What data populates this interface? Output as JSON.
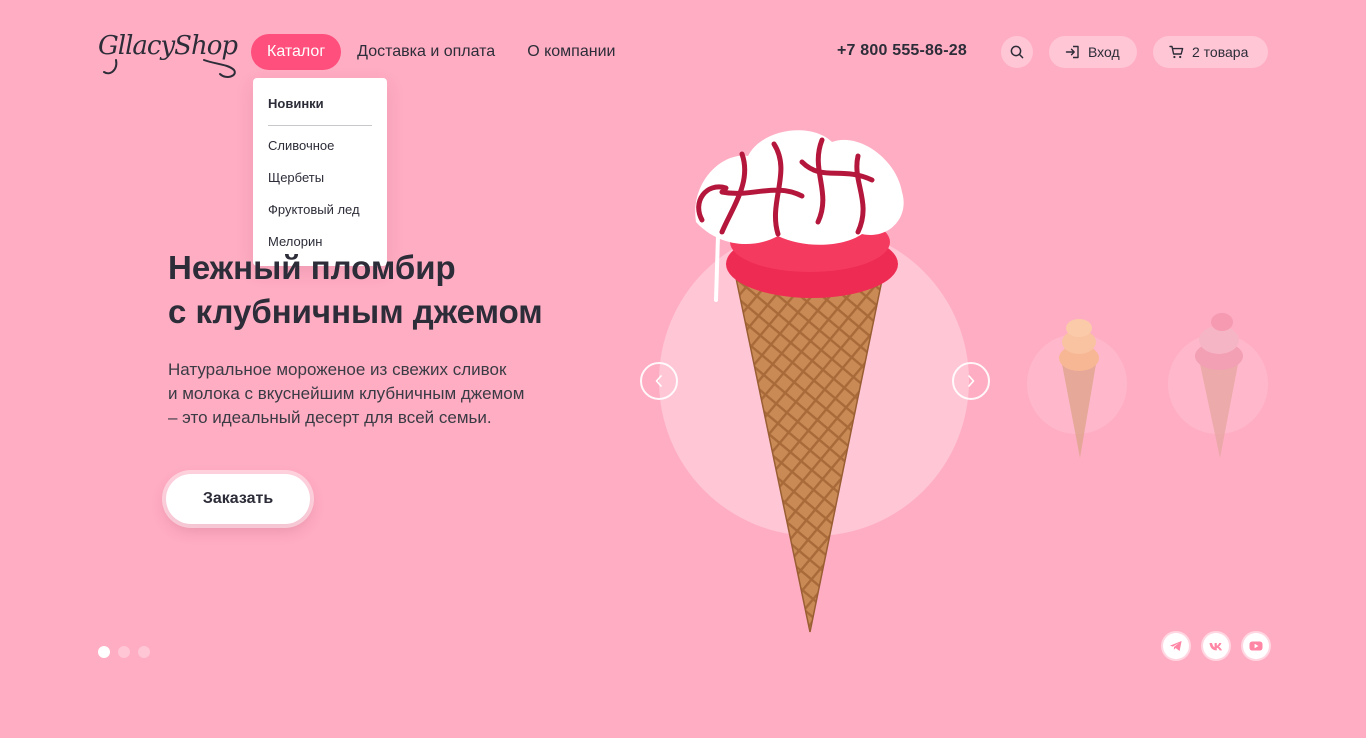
{
  "header": {
    "logo_text": "GllacyShop",
    "nav": [
      {
        "label": "Каталог",
        "active": true
      },
      {
        "label": "Доставка и оплата",
        "active": false
      },
      {
        "label": "О компании",
        "active": false
      }
    ],
    "phone": "+7 800 555-86-28",
    "search_icon": "search-icon",
    "login_label": "Вход",
    "login_icon": "sign-in-icon",
    "cart_label": "2 товара",
    "cart_icon": "cart-icon"
  },
  "dropdown": {
    "head": "Новинки",
    "items": [
      "Сливочное",
      "Щербеты",
      "Фруктовый лед",
      "Мелорин"
    ]
  },
  "hero": {
    "title_lines": [
      "Нежный пломбир",
      "с клубничным джемом"
    ],
    "text_lines": [
      "Натуральное мороженое из свежих сливок",
      "и молока с вкуснейшим клубничным джемом",
      "– это идеальный десерт для всей семьи."
    ],
    "cta_label": "Заказать"
  },
  "slider": {
    "prev_icon": "chevron-left-icon",
    "next_icon": "chevron-right-icon",
    "dots": 3,
    "active_dot": 0
  },
  "socials": [
    "telegram-icon",
    "vk-icon",
    "youtube-icon"
  ],
  "colors": {
    "background": "#ffadc3",
    "accent": "#ff4f7c",
    "circle": "#ffc6d6",
    "text": "#2c2d38"
  }
}
